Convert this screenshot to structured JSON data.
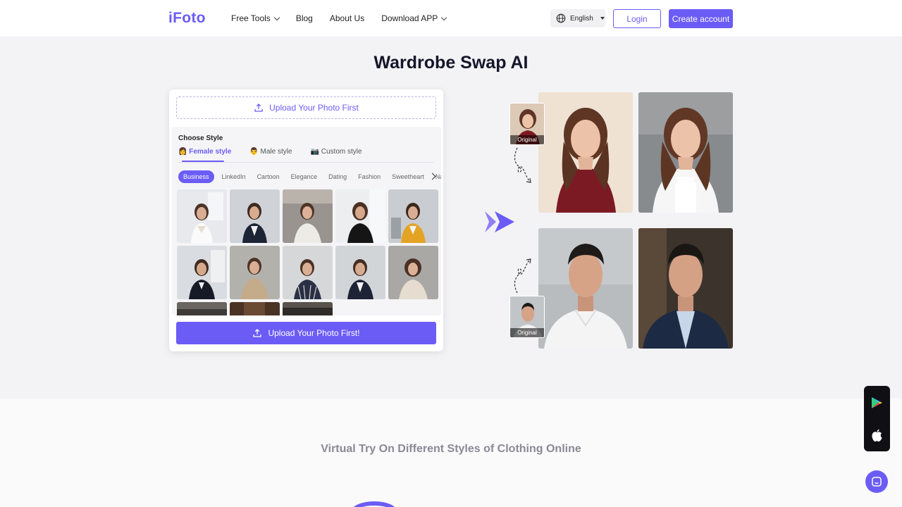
{
  "header": {
    "logo": "iFoto",
    "nav": [
      {
        "label": "Free Tools",
        "dropdown": true
      },
      {
        "label": "Blog",
        "dropdown": false
      },
      {
        "label": "About Us",
        "dropdown": false
      },
      {
        "label": "Download APP",
        "dropdown": true
      }
    ],
    "language": "English",
    "login": "Login",
    "create_account": "Create account"
  },
  "main": {
    "title": "Wardrobe Swap AI",
    "upload_top": "Upload Your Photo First",
    "choose_style": "Choose Style",
    "style_tabs": [
      {
        "icon": "👩",
        "label": "Female style",
        "active": true
      },
      {
        "icon": "👨",
        "label": "Male style",
        "active": false
      },
      {
        "icon": "📷",
        "label": "Custom style",
        "active": false
      }
    ],
    "categories": [
      "Business",
      "LinkedIn",
      "Cartoon",
      "Elegance",
      "Dating",
      "Fashion",
      "Sweetheart",
      "Nature"
    ],
    "active_category": "Business",
    "upload_bottom": "Upload Your Photo First!",
    "original_label": "Original",
    "original_label_2": "Original"
  },
  "lower": {
    "subtitle": "Virtual Try On Different Styles of Clothing Online"
  },
  "colors": {
    "accent": "#6b5cf6",
    "page_bg": "#f3f3f5"
  }
}
